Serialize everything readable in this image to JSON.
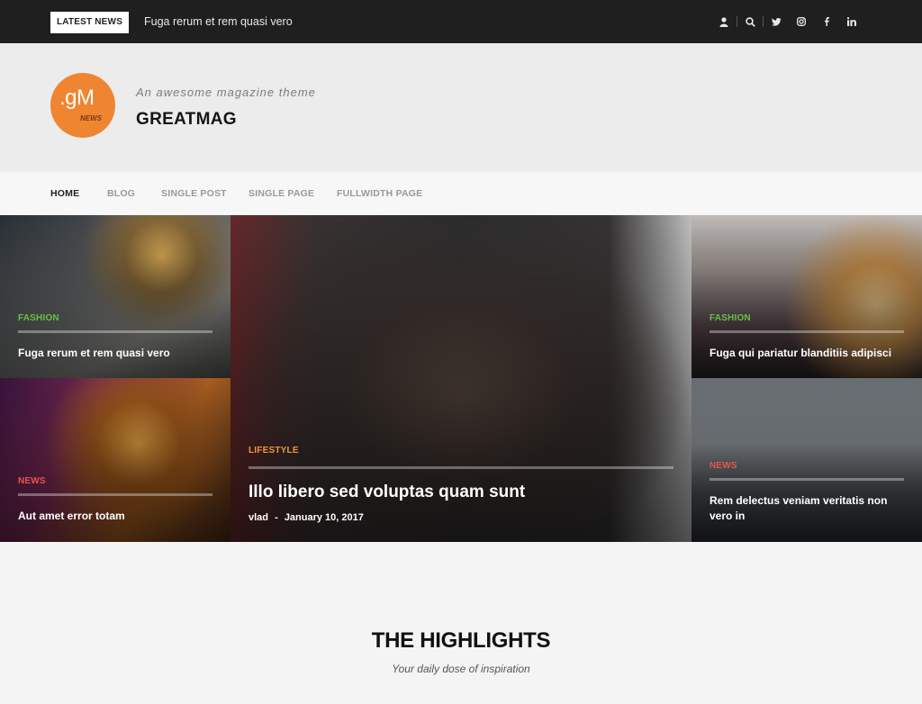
{
  "topbar": {
    "latest_label": "LATEST NEWS",
    "latest_text": "Fuga rerum et rem quasi vero",
    "icons": [
      "user-icon",
      "search-icon",
      "twitter-icon",
      "instagram-icon",
      "facebook-icon",
      "linkedin-icon"
    ]
  },
  "header": {
    "logo_main": ".gM",
    "logo_sub": "NEWS",
    "tagline": "An awesome magazine theme",
    "site_title": "GREATMAG"
  },
  "nav": {
    "items": [
      {
        "label": "HOME"
      },
      {
        "label": "BLOG"
      },
      {
        "label": "SINGLE POST"
      },
      {
        "label": "SINGLE PAGE"
      },
      {
        "label": "FULLWIDTH PAGE"
      }
    ]
  },
  "hero": {
    "tiles": [
      {
        "category": "FASHION",
        "title": "Fuga rerum et rem quasi vero"
      },
      {
        "category": "NEWS",
        "title": "Aut amet error totam"
      },
      {
        "category": "LIFESTYLE",
        "title": "Illo libero sed voluptas quam sunt",
        "author": "vlad",
        "date": "January 10, 2017"
      },
      {
        "category": "FASHION",
        "title": "Fuga qui pariatur blanditiis adipisci"
      },
      {
        "category": "NEWS",
        "title": "Rem delectus veniam veritatis non vero in"
      }
    ]
  },
  "highlights": {
    "title": "THE HIGHLIGHTS",
    "subtitle": "Your daily dose of inspiration"
  },
  "colors": {
    "fashion": "#6abf47",
    "news": "#e2574c",
    "lifestyle": "#f0953e",
    "logo": "#ef8531",
    "topbar": "#1f1f1f"
  }
}
